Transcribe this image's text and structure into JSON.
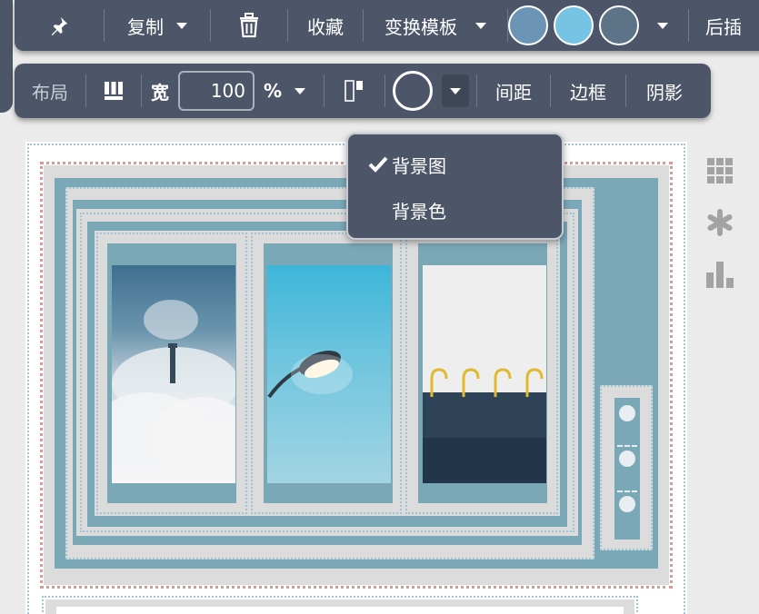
{
  "toolbar_top": {
    "pin_icon": "pin-icon",
    "copy_label": "复制",
    "delete_icon": "trash-icon",
    "favorite_label": "收藏",
    "template_label": "变换模板",
    "swatches": [
      "#6c94b4",
      "#76c3e4",
      "#5d7388"
    ],
    "insert_after_label": "后插"
  },
  "toolbar_layout": {
    "layout_label": "布局",
    "grid_icon": "grid-icon",
    "width_label": "宽",
    "width_value": "100",
    "width_unit": "%",
    "align_icon": "align-top-icon",
    "spacing_label": "间距",
    "border_label": "边框",
    "shadow_label": "阴影"
  },
  "background_menu": {
    "items": [
      {
        "label": "背景图",
        "checked": true
      },
      {
        "label": "背景色",
        "checked": false
      }
    ]
  },
  "right_panel_icons": [
    "grid-dots-icon",
    "asterisk-icon",
    "bar-chart-icon"
  ],
  "colors": {
    "toolbar_bg": "#4d5668",
    "block_blue": "#7aa8b7",
    "dotted_border": "#9ec4d6"
  }
}
